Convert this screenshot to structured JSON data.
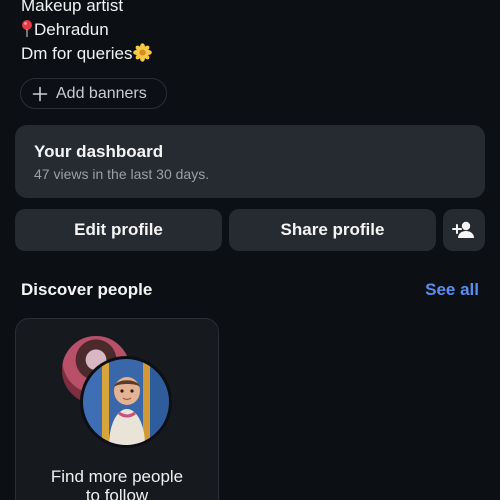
{
  "profile": {
    "bio_line1": "Makeup artist",
    "bio_line2": "Dehradun",
    "bio_line3": "Dm for queries"
  },
  "banners": {
    "label": "Add banners"
  },
  "dashboard": {
    "title": "Your dashboard",
    "subtitle": "47 views in the last 30 days."
  },
  "actions": {
    "edit_label": "Edit profile",
    "share_label": "Share profile"
  },
  "discover": {
    "title": "Discover people",
    "see_all": "See all",
    "card_text_line1": "Find more people",
    "card_text_line2": "to follow"
  },
  "icons": {
    "pin": "location-pin-icon",
    "flower": "flower-icon",
    "plus": "plus-icon",
    "add_person": "add-person-icon"
  },
  "colors": {
    "background": "#0c0f14",
    "surface": "#262a31",
    "accent_link": "#5b8def",
    "muted_text": "#9aa0a8"
  }
}
